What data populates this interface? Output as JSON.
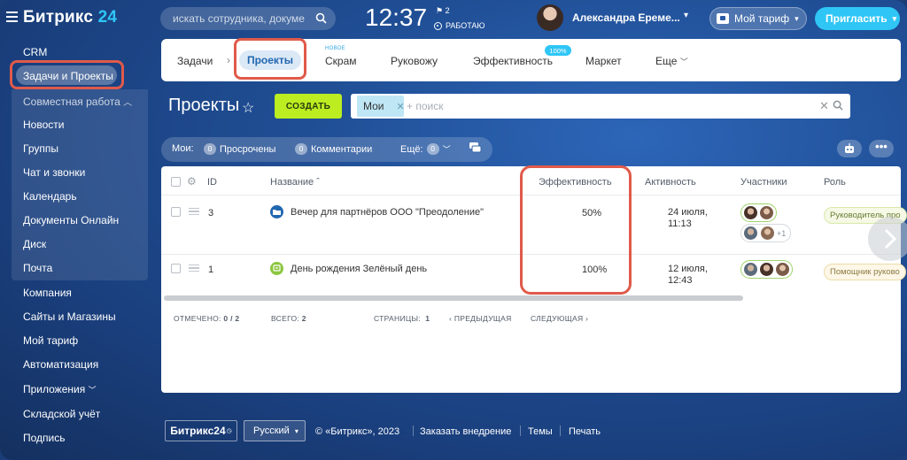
{
  "topbar": {
    "logo_text": "Битрикс",
    "logo_num": "24",
    "search_placeholder": "искать сотрудника, докуме...",
    "clock": "12:37",
    "flag_count": "2",
    "work_status": "РАБОТАЮ",
    "user_name": "Александра Ереме...",
    "tariff_label": "Мой тариф",
    "invite_label": "Пригласить"
  },
  "sidebar": {
    "items": [
      {
        "label": "CRM"
      },
      {
        "label": "Задачи и Проекты"
      },
      {
        "label": "Совместная работа"
      },
      {
        "label": "Новости"
      },
      {
        "label": "Группы"
      },
      {
        "label": "Чат и звонки"
      },
      {
        "label": "Календарь"
      },
      {
        "label": "Документы Онлайн"
      },
      {
        "label": "Диск"
      },
      {
        "label": "Почта"
      },
      {
        "label": "Компания"
      },
      {
        "label": "Сайты и Магазины"
      },
      {
        "label": "Мой тариф"
      },
      {
        "label": "Автоматизация"
      },
      {
        "label": "Приложения"
      },
      {
        "label": "Складской учёт"
      },
      {
        "label": "Подпись"
      }
    ]
  },
  "tabs": {
    "tasks": "Задачи",
    "projects": "Проекты",
    "scrum": "Скрам",
    "scrum_badge": "НОВОЕ",
    "manage": "Руковожу",
    "efficiency": "Эффективность",
    "efficiency_badge": "100%",
    "market": "Маркет",
    "more": "Еще"
  },
  "page": {
    "title": "Проекты",
    "create_label": "СОЗДАТЬ",
    "filter_chip": "Мои",
    "filter_placeholder": "+ поиск"
  },
  "counters": {
    "label": "Мои:",
    "overdue_count": "0",
    "overdue_label": "Просрочены",
    "comments_count": "0",
    "comments_label": "Комментарии",
    "more_label": "Ещё:",
    "more_count": "0"
  },
  "grid": {
    "headers": {
      "id": "ID",
      "name": "Название",
      "efficiency": "Эффективность",
      "activity": "Активность",
      "members": "Участники",
      "role": "Роль"
    },
    "rows": [
      {
        "id": "3",
        "name": "Вечер для партнёров ООО \"Преодоление\"",
        "efficiency": "50%",
        "activity_date": "24 июля,",
        "activity_time": "11:13",
        "members_extra": "+1",
        "role": "Руководитель про"
      },
      {
        "id": "1",
        "name": "День рождения Зелёный день",
        "efficiency": "100%",
        "activity_date": "12 июля,",
        "activity_time": "12:43",
        "role": "Помощник руково"
      }
    ],
    "footer": {
      "selected_label": "ОТМЕЧЕНО:",
      "selected_value": "0 / 2",
      "total_label": "ВСЕГО:",
      "total_value": "2",
      "pages_label": "СТРАНИЦЫ:",
      "pages_value": "1",
      "prev": "ПРЕДЫДУЩАЯ",
      "next": "СЛЕДУЮЩАЯ"
    }
  },
  "footer": {
    "logo": "Битрикс24",
    "language": "Русский",
    "copyright": "© «Битрикс», 2023",
    "order": "Заказать внедрение",
    "themes": "Темы",
    "print": "Печать"
  },
  "colors": {
    "accent": "#2fc6f6",
    "create_button": "#bbed21",
    "highlight": "#e05a4a",
    "folder_icon": "#2067b0",
    "group_icon": "#8cc63e"
  }
}
